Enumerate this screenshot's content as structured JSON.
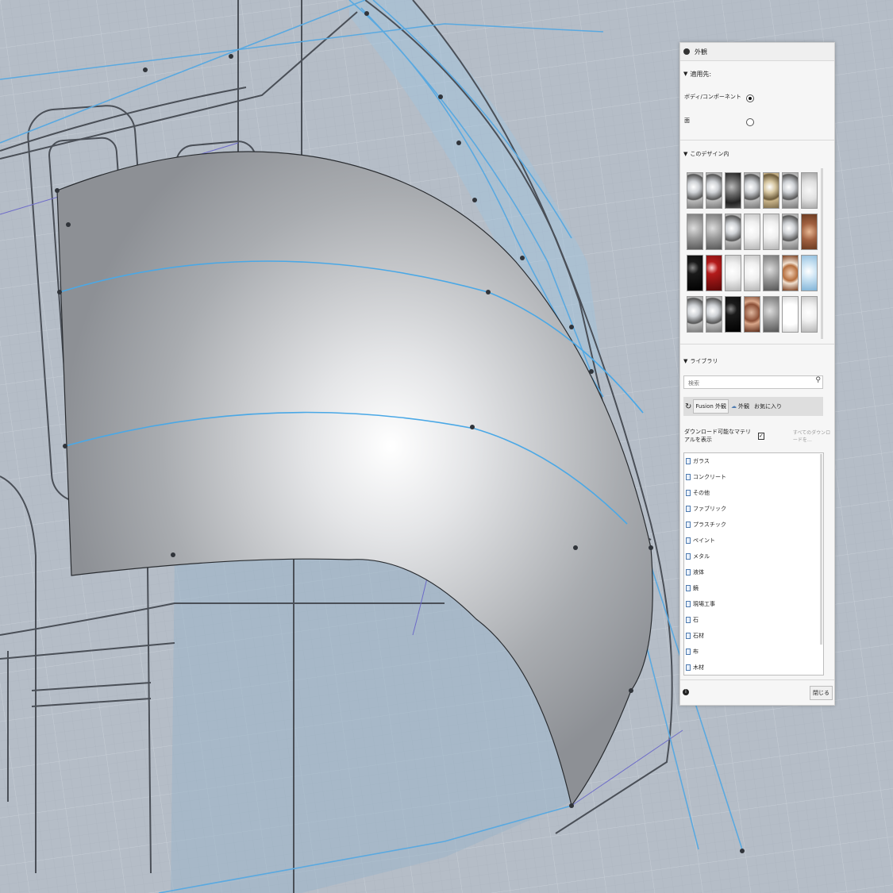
{
  "panel": {
    "title": "外観",
    "apply_to": {
      "heading": "適用先:",
      "options": [
        {
          "label": "ボディ/コンポーネント",
          "selected": true
        },
        {
          "label": "面",
          "selected": false
        }
      ]
    },
    "in_design": {
      "heading": "このデザイン内",
      "swatches": [
        "chrome",
        "chrome",
        "dark-chrome",
        "chrome",
        "gold",
        "chrome",
        "white-pearl",
        "grey",
        "grey",
        "chrome",
        "white",
        "white",
        "chrome",
        "copper",
        "black",
        "red",
        "white",
        "white",
        "grey",
        "copper-ring",
        "light-blue",
        "chrome",
        "chrome",
        "black",
        "bronze",
        "grey",
        "white-glow",
        "white"
      ]
    },
    "library": {
      "heading": "ライブラリ",
      "search_placeholder": "検索",
      "tabs": [
        "Fusion 外観",
        "外観",
        "お気に入り"
      ],
      "show_downloadable_label": "ダウンロード可能なマテリアルを表示",
      "show_downloadable_checked": true,
      "download_all_label": "すべてのダウンロードを…",
      "folders": [
        "ガラス",
        "コンクリート",
        "その他",
        "ファブリック",
        "プラスチック",
        "ペイント",
        "メタル",
        "液体",
        "鏡",
        "現場工事",
        "石",
        "石材",
        "布",
        "木材"
      ]
    },
    "close_label": "閉じる",
    "colors": {
      "accent": "#5aa9e0",
      "panel_bg": "#f6f6f6"
    }
  }
}
